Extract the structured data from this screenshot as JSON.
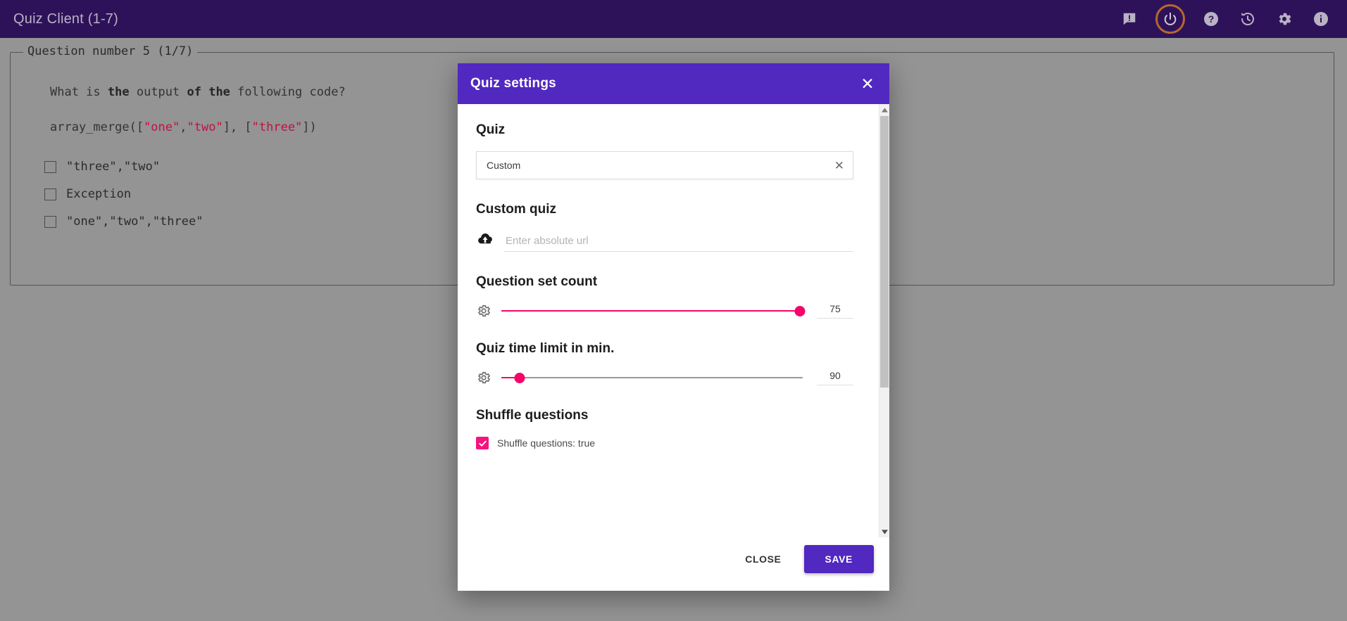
{
  "appbar": {
    "title": "Quiz Client (1-7)",
    "icons": [
      {
        "name": "feedback-icon",
        "glyph": "!"
      },
      {
        "name": "power-icon",
        "glyph": ""
      },
      {
        "name": "help-icon",
        "glyph": "?"
      },
      {
        "name": "history-icon",
        "glyph": ""
      },
      {
        "name": "settings-gear-icon",
        "glyph": ""
      },
      {
        "name": "info-icon",
        "glyph": "i"
      }
    ],
    "colors": {
      "bar": "#2e1259",
      "title": "#b9b2c4",
      "power_ring": "#b5672e"
    }
  },
  "question": {
    "legend": "Question number 5 (1/7)",
    "prompt_pre": "What is ",
    "prompt_b1": "the",
    "prompt_mid": " output ",
    "prompt_b2": "of the",
    "prompt_post": " following code?",
    "code_pre": "array_merge([",
    "code_s1": "\"one\"",
    "code_comma1": ",",
    "code_s2": "\"two\"",
    "code_mid": "], [",
    "code_s3": "\"three\"",
    "code_post": "])",
    "options": [
      {
        "label": "\"three\",\"two\"",
        "checked": false
      },
      {
        "label": "Exception",
        "checked": false
      },
      {
        "label": "\"one\",\"two\",\"three\"",
        "checked": false
      }
    ]
  },
  "dialog": {
    "title": "Quiz settings",
    "close_icon": "✕",
    "sections": {
      "quiz": {
        "heading": "Quiz",
        "selected_value": "Custom",
        "clear_icon": "✕"
      },
      "custom_quiz": {
        "heading": "Custom quiz",
        "url_value": "",
        "url_placeholder": "Enter absolute url",
        "icon": "cloud-upload-icon"
      },
      "question_set_count": {
        "heading": "Question set count",
        "value": "75",
        "fill_percent": 99,
        "icon": "gear-icon"
      },
      "quiz_time_limit": {
        "heading": "Quiz time limit in min.",
        "value": "90",
        "fill_percent": 6,
        "icon": "gear-icon"
      },
      "shuffle_questions": {
        "heading": "Shuffle questions",
        "checkbox_label": "Shuffle questions: true",
        "checked": true
      }
    },
    "footer": {
      "close_label": "CLOSE",
      "save_label": "SAVE"
    },
    "colors": {
      "header": "#5128c0",
      "accent_pink": "#f5046a",
      "checkbox_pink": "#f4157f",
      "save_button": "#5128c0"
    }
  }
}
